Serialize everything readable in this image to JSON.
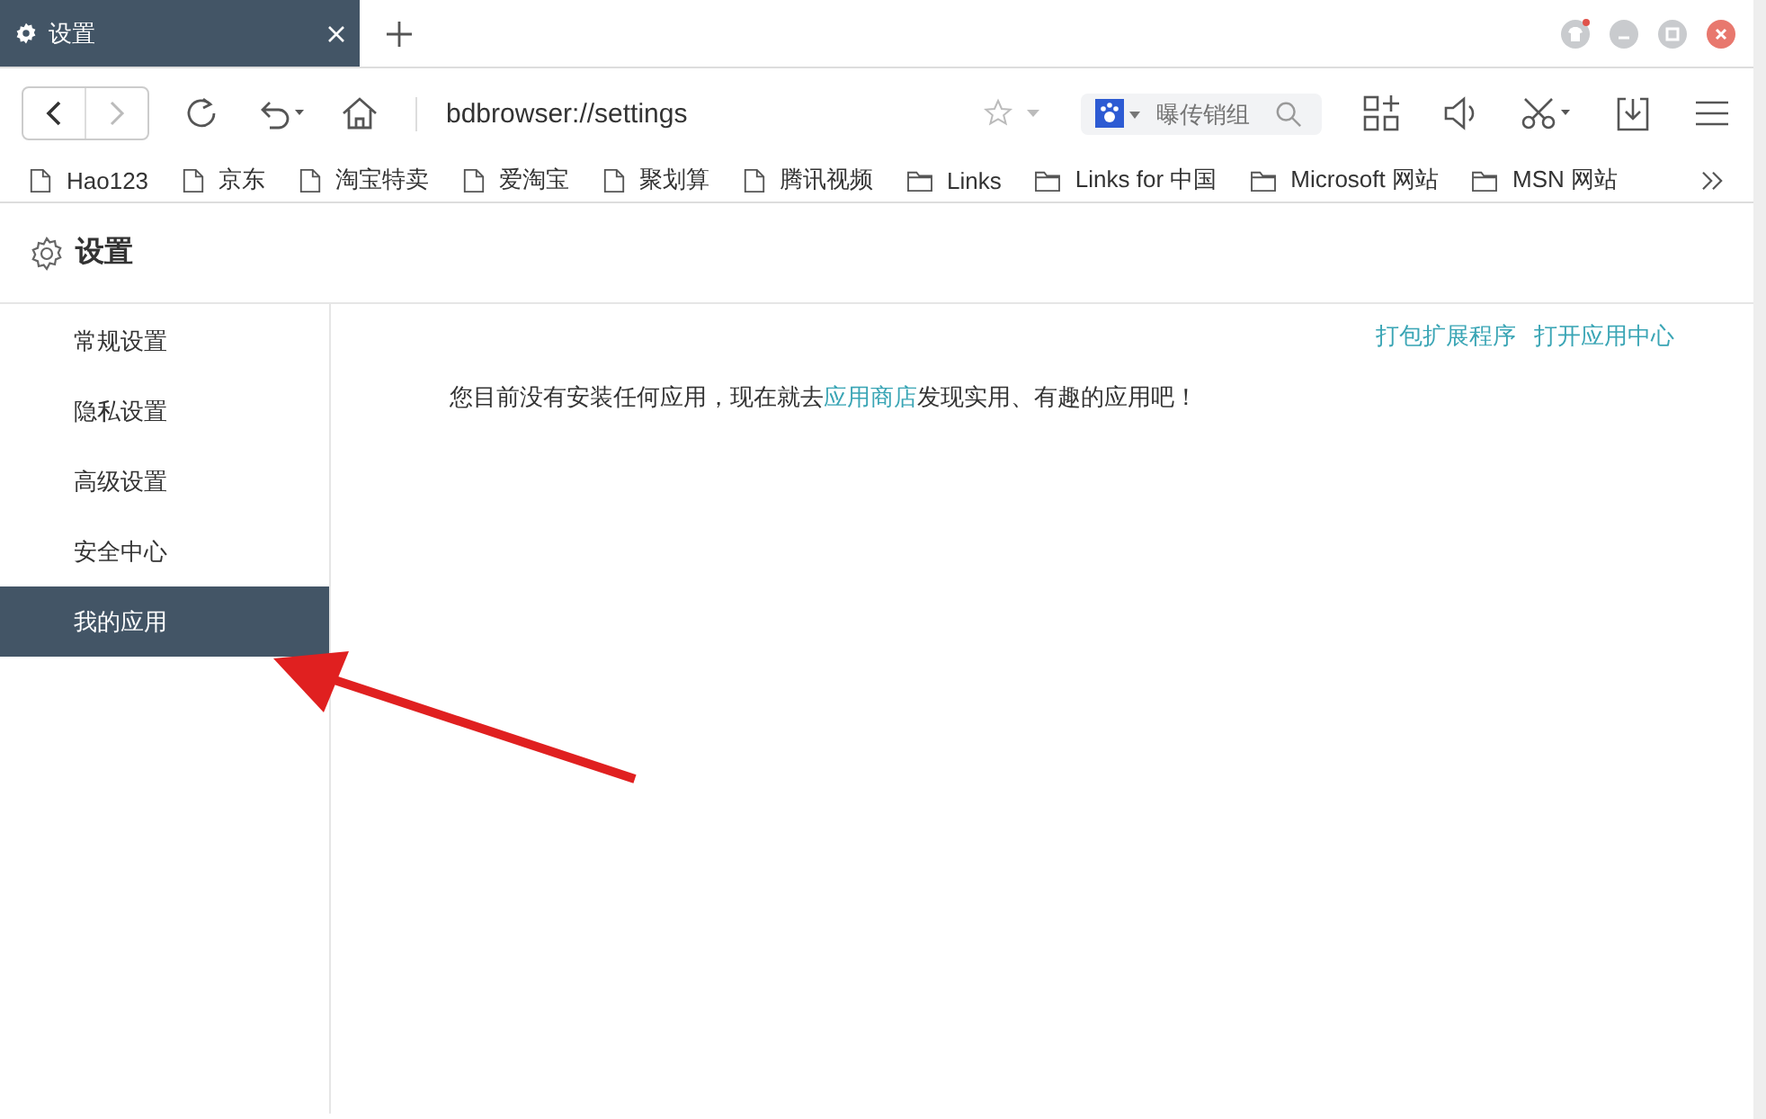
{
  "tabs": [
    {
      "label": "设置",
      "selected": true
    }
  ],
  "address": {
    "value": "bdbrowser://settings"
  },
  "search": {
    "placeholder": "曝传销组"
  },
  "bookmarks": [
    {
      "label": "Hao123",
      "kind": "page"
    },
    {
      "label": "京东",
      "kind": "page"
    },
    {
      "label": "淘宝特卖",
      "kind": "page"
    },
    {
      "label": "爱淘宝",
      "kind": "page"
    },
    {
      "label": "聚划算",
      "kind": "page"
    },
    {
      "label": "腾讯视频",
      "kind": "page"
    },
    {
      "label": "Links",
      "kind": "folder"
    },
    {
      "label": "Links for 中国",
      "kind": "folder"
    },
    {
      "label": "Microsoft 网站",
      "kind": "folder"
    },
    {
      "label": "MSN 网站",
      "kind": "folder"
    }
  ],
  "page_title": "设置",
  "sidebar": {
    "items": [
      {
        "label": "常规设置",
        "selected": false
      },
      {
        "label": "隐私设置",
        "selected": false
      },
      {
        "label": "高级设置",
        "selected": false
      },
      {
        "label": "安全中心",
        "selected": false
      },
      {
        "label": "我的应用",
        "selected": true
      }
    ]
  },
  "content": {
    "links": [
      "打包扩展程序",
      "打开应用中心"
    ],
    "message": {
      "before": "您目前没有安装任何应用，现在就去",
      "link": "应用商店",
      "after": "发现实用、有趣的应用吧！"
    }
  }
}
